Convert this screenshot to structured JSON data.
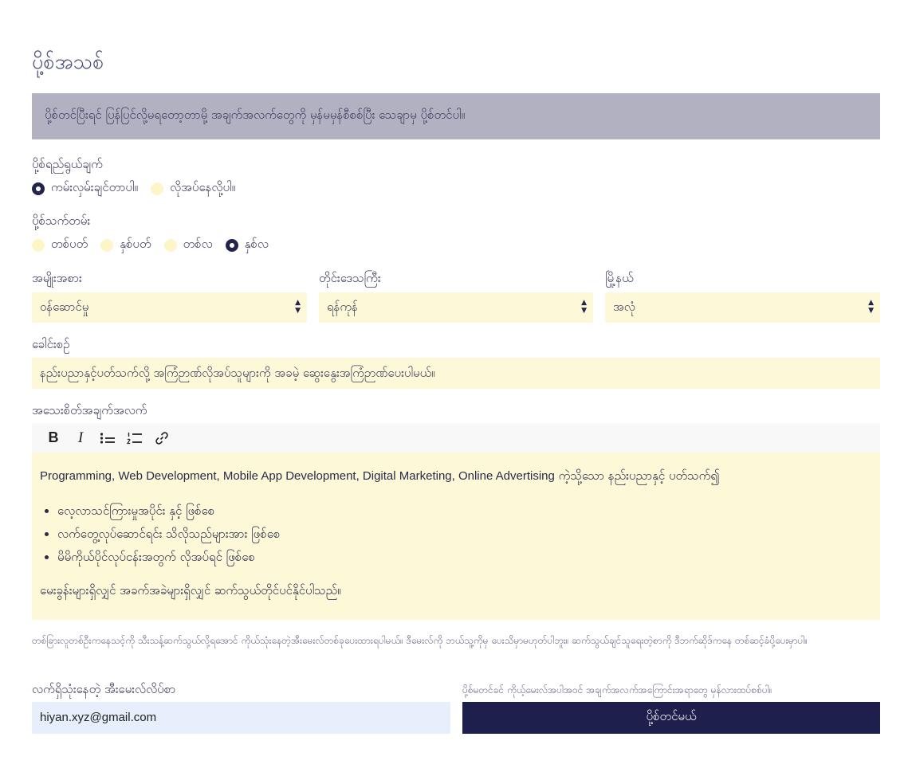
{
  "title": "ပို့စ်အသစ်",
  "notice": "ပို့စ်တင်ပြီးရင် ပြန်ပြင်လို့မရတော့တာမို့ အချက်အလက်တွေကို မှန်မမှန်စီစစ်ပြီး သေချာမှ ပို့စ်တင်ပါ။",
  "purpose": {
    "label": "ပို့စ်ရည်ရွယ်ချက်",
    "options": [
      {
        "label": "ကမ်းလှမ်းချင်တာပါ။",
        "checked": true
      },
      {
        "label": "လိုအပ်နေလို့ပါ။",
        "checked": false
      }
    ]
  },
  "duration": {
    "label": "ပို့စ်သက်တမ်း",
    "options": [
      {
        "label": "တစ်ပတ်",
        "checked": false
      },
      {
        "label": "နှစ်ပတ်",
        "checked": false
      },
      {
        "label": "တစ်လ",
        "checked": false
      },
      {
        "label": "နှစ်လ",
        "checked": true
      }
    ]
  },
  "category": {
    "label": "အမျိုးအစား",
    "value": "ဝန်ဆောင်မှု"
  },
  "region": {
    "label": "တိုင်းဒေသကြီး",
    "value": "ရန်ကုန်"
  },
  "township": {
    "label": "မြို့နယ်",
    "value": "အလုံ"
  },
  "heading": {
    "label": "ခေါင်းစဉ်",
    "value": "နည်းပညာနှင့်ပတ်သက်လို့ အကြံဉာဏ်လိုအပ်သူများကို အခမဲ့ ဆွေးနွေးအကြံဉာဏ်ပေးပါမယ်။"
  },
  "details": {
    "label": "အသေးစိတ်အချက်အလက်",
    "toolbar": {
      "bold": "B",
      "italic": "I",
      "bullet_icon": "bullet-list-icon",
      "number_icon": "numbered-list-icon",
      "link_icon": "link-icon"
    },
    "para1_en": "Programming, Web Development, Mobile App Development, Digital Marketing, Online Advertising",
    "para1_mm": " ကဲ့သို့သော နည်းပညာနှင့် ပတ်သက်၍",
    "bullets": [
      "လေ့လာသင်ကြားမှုအပိုင်း နှင့် ဖြစ်စေ",
      "လက်တွေ့လုပ်ဆောင်ရင်း သိလိုသည်များအား ဖြစ်စေ",
      "မိမိကိုယ်ပိုင်လုပ်ငန်းအတွက် လိုအပ်ရင် ဖြစ်စေ"
    ],
    "para2": "မေးခွန်းများရှိလျှင် အခက်အခဲများရှိလျှင် ဆက်သွယ်တိုင်ပင်နိုင်ပါသည်။"
  },
  "help_text": "တစ်ခြားလူတစ်ဦးကနေသင့်ကို သီးသန့်ဆက်သွယ်လို့ရအောင် ကိုယ်သုံးနေတဲ့အီးမေးလ်တစ်ခုပေးထားရပါမယ်။ ဒီမေးလ်ကို ဘယ်သူ့ကိုမှ ပေးသိမှာမဟုတ်ပါဘူး။ ဆက်သွယ်ချင်သူရေးတဲ့စာကို ဒီဘက်ဆိုဒ်ကနေ တစ်ဆင့်ခံပို့ပေးမှာပါ။",
  "email": {
    "label": "လက်ရှိသုံးနေတဲ့ အီးမေးလ်လိပ်စာ",
    "value": "hiyan.xyz@gmail.com"
  },
  "submit": {
    "hint": "ပို့စ်မတင်ခင် ကိုယ့်မေးလ်အပါအဝင် အချက်အလက်အကြောင်းအရာတွေ မှန်လားထပ်စစ်ပါ။",
    "label": "ပို့စ်တင်မယ်"
  },
  "colors": {
    "field_bg": "#fdf8d8",
    "notice_bg": "#b1b1c2",
    "accent": "#1f1f4e",
    "email_bg": "#e6effb"
  }
}
